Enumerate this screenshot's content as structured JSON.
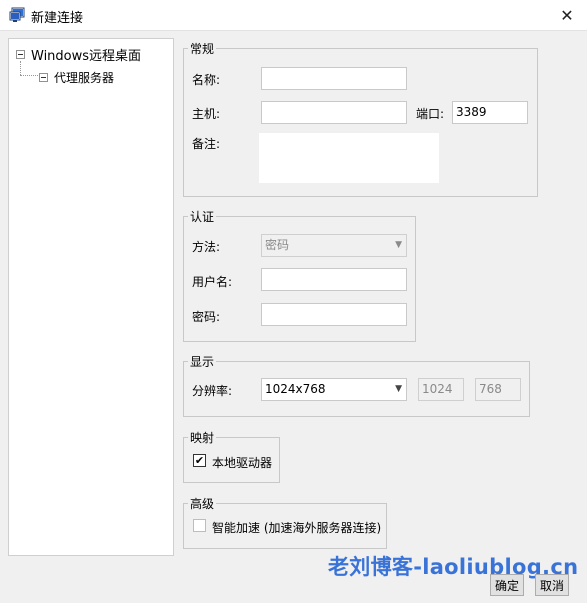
{
  "window": {
    "title": "新建连接",
    "close_glyph": "✕"
  },
  "tree": {
    "root_label": "Windows远程桌面",
    "child_label": "代理服务器"
  },
  "general": {
    "legend": "常规",
    "name_label": "名称:",
    "name_value": "",
    "host_label": "主机:",
    "host_value": "",
    "port_label": "端口:",
    "port_value": "3389",
    "note_label": "备注:",
    "note_value": ""
  },
  "auth": {
    "legend": "认证",
    "method_label": "方法:",
    "method_value": "密码",
    "username_label": "用户名:",
    "username_value": "",
    "password_label": "密码:",
    "password_value": ""
  },
  "display": {
    "legend": "显示",
    "resolution_label": "分辨率:",
    "resolution_value": "1024x768",
    "width_value": "1024",
    "height_value": "768"
  },
  "mapping": {
    "legend": "映射",
    "local_drives_label": "本地驱动器",
    "local_drives_checked": true
  },
  "advanced": {
    "legend": "高级",
    "accel_label": "智能加速 (加速海外服务器连接)",
    "accel_checked": false
  },
  "watermark": "老刘博客-laoliublog.cn",
  "buttons": {
    "ok": "确定",
    "cancel": "取消"
  },
  "icons": {
    "app": "remote-desktop-icon",
    "dropdown": "chevron-down-icon",
    "check": "checkmark-icon"
  }
}
